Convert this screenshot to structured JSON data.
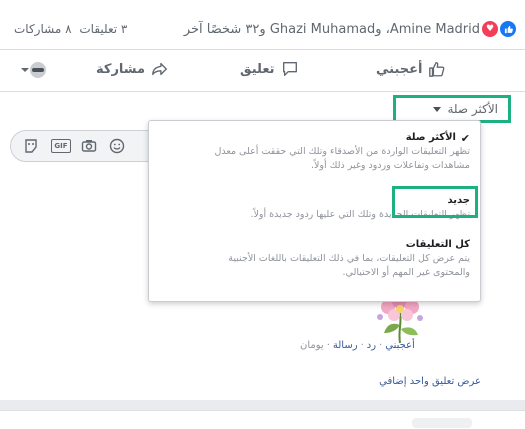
{
  "summary": {
    "reactors_text": "Amine Madrid، وGhazi Muhamad و٣٢ شخصًا آخر",
    "comments_count": "٣ تعليقات",
    "shares_count": "٨ مشاركات"
  },
  "actions": {
    "like": "أعجبني",
    "comment": "تعليق",
    "share": "مشاركة"
  },
  "sort": {
    "current": "الأكثر صلة"
  },
  "menu": {
    "items": [
      {
        "title": "الأكثر صلة",
        "description": "تظهر التعليقات الواردة من الأصدقاء وتلك التي حققت أعلى معدل مشاهدات وتفاعلات وردود وغير ذلك أولاً.",
        "selected": true
      },
      {
        "title": "جديد",
        "description": "تظهر التعليقات الجديدة وتلك التي عليها ردود جديدة أولاً.",
        "selected": false
      },
      {
        "title": "كل التعليقات",
        "description": "يتم عرض كل التعليقات، بما في ذلك التعليقات باللغات الأجنبية والمحتوى غير المهم أو الاحتيالي.",
        "selected": false
      }
    ]
  },
  "comment_actions": {
    "like": "أعجبني",
    "reply": "رد",
    "message": "رسالة",
    "time": "يومان"
  },
  "more_comments": "عرض تعليق واحد إضافي",
  "colors": {
    "highlight": "#1db181",
    "link": "#385898",
    "like_icon": "#1877f2",
    "love_icon": "#f33e58"
  }
}
